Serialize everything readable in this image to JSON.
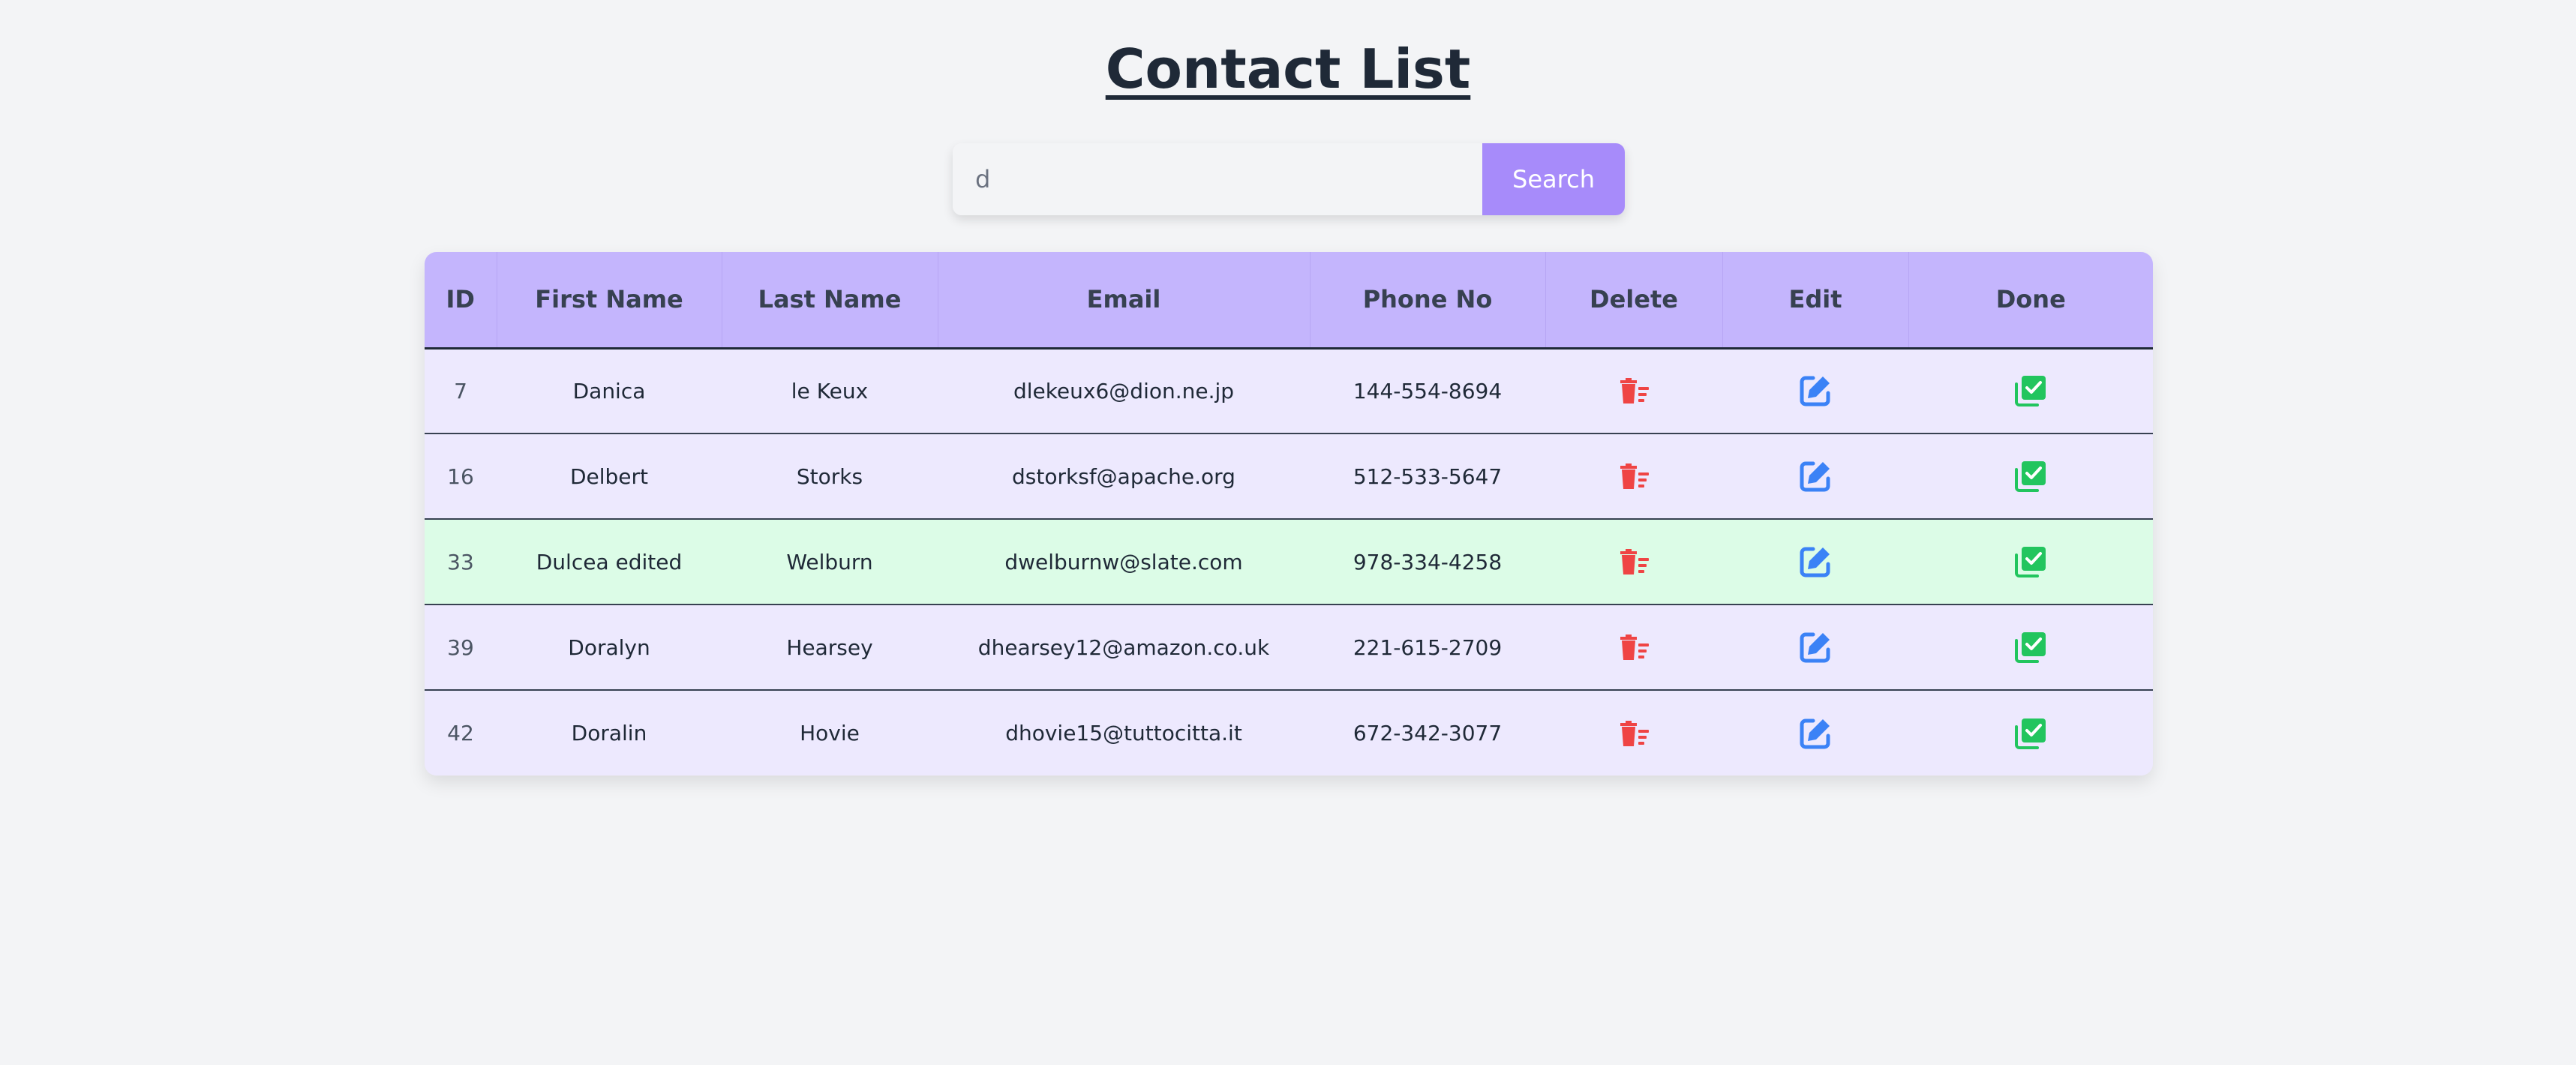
{
  "page": {
    "title": "Contact List"
  },
  "search": {
    "value": "d",
    "button_label": "Search"
  },
  "table": {
    "columns": [
      "ID",
      "First Name",
      "Last Name",
      "Email",
      "Phone No",
      "Delete",
      "Edit",
      "Done"
    ],
    "rows": [
      {
        "id": "7",
        "first_name": "Danica",
        "last_name": "le Keux",
        "email": "dlekeux6@dion.ne.jp",
        "phone": "144-554-8694",
        "done": false
      },
      {
        "id": "16",
        "first_name": "Delbert",
        "last_name": "Storks",
        "email": "dstorksf@apache.org",
        "phone": "512-533-5647",
        "done": false
      },
      {
        "id": "33",
        "first_name": "Dulcea edited",
        "last_name": "Welburn",
        "email": "dwelburnw@slate.com",
        "phone": "978-334-4258",
        "done": true
      },
      {
        "id": "39",
        "first_name": "Doralyn",
        "last_name": "Hearsey",
        "email": "dhearsey12@amazon.co.uk",
        "phone": "221-615-2709",
        "done": false
      },
      {
        "id": "42",
        "first_name": "Doralin",
        "last_name": "Hovie",
        "email": "dhovie15@tuttocitta.it",
        "phone": "672-342-3077",
        "done": false
      }
    ]
  },
  "icons": {
    "delete": "trash-icon",
    "edit": "edit-icon",
    "done": "check-square-icon"
  },
  "colors": {
    "header_bg": "#c4b5fd",
    "row_bg": "#ede9fe",
    "done_row_bg": "#dcfce7",
    "search_button": "#a78bfa",
    "delete_icon": "#ef4444",
    "edit_icon": "#3b82f6",
    "done_icon": "#22c55e"
  }
}
